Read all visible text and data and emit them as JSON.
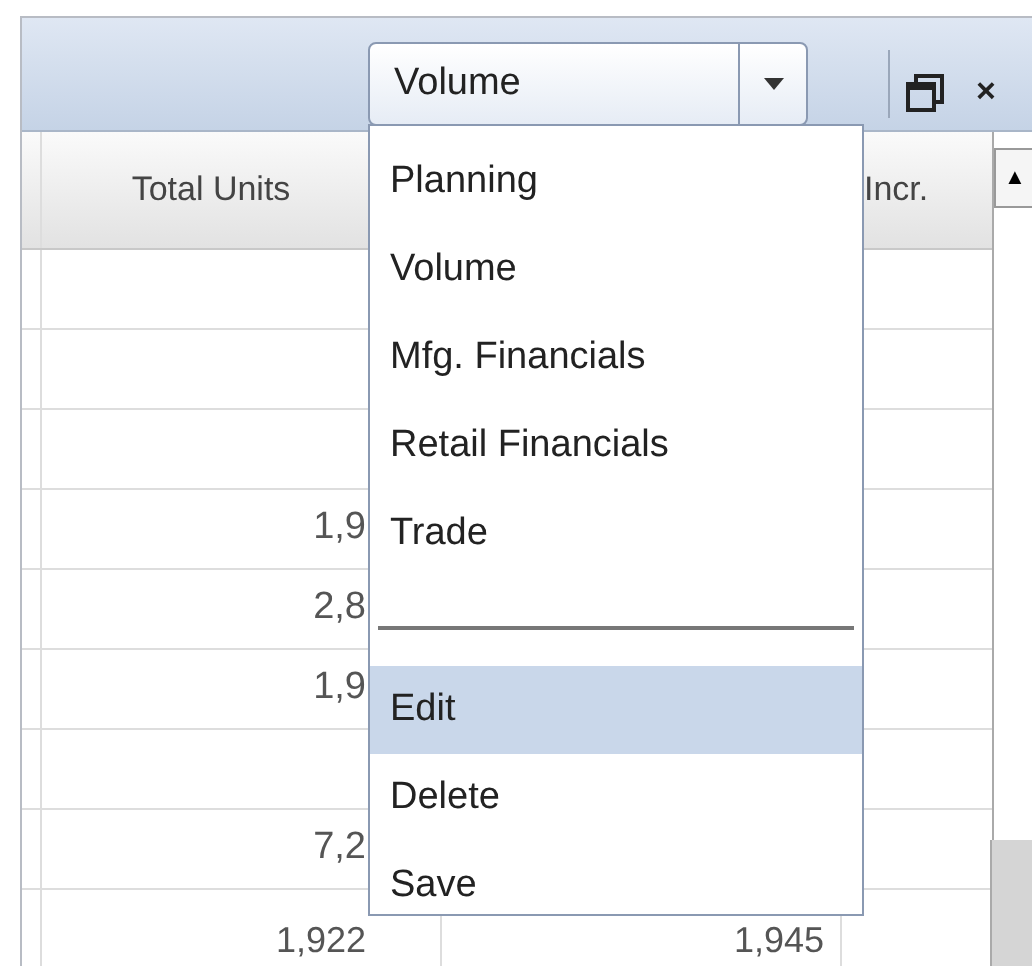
{
  "toolbar": {
    "view_select": {
      "value": "Volume"
    },
    "close_label": "×"
  },
  "table": {
    "columns": [
      {
        "label": "Total Units"
      },
      {},
      {
        "label": "Incr."
      }
    ],
    "rows": [
      {},
      {},
      {},
      {
        "cells": [
          "1,9"
        ]
      },
      {
        "cells": [
          "2,8"
        ]
      },
      {
        "cells": [
          "1,9"
        ]
      },
      {},
      {
        "cells": [
          "7,2"
        ]
      },
      {
        "cells": [
          "1,922",
          "1,945"
        ]
      }
    ]
  },
  "scrollbar": {
    "up_label": "▲"
  },
  "dropdown_menu": {
    "items": [
      {
        "kind": "item",
        "label": "Planning",
        "selected": false
      },
      {
        "kind": "item",
        "label": "Volume",
        "selected": false
      },
      {
        "kind": "item",
        "label": "Mfg. Financials",
        "selected": false
      },
      {
        "kind": "item",
        "label": "Retail Financials",
        "selected": false
      },
      {
        "kind": "item",
        "label": "Trade",
        "selected": false
      },
      {
        "kind": "separator"
      },
      {
        "kind": "item",
        "label": "Edit",
        "selected": true
      },
      {
        "kind": "item",
        "label": "Delete",
        "selected": false
      },
      {
        "kind": "item",
        "label": "Save",
        "selected": false
      }
    ]
  }
}
